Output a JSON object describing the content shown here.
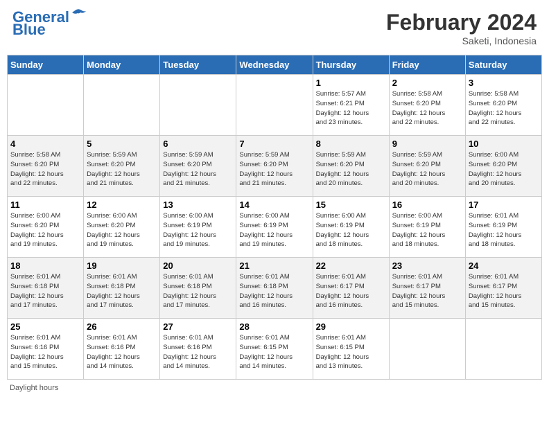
{
  "header": {
    "logo_line1": "General",
    "logo_line2": "Blue",
    "month_title": "February 2024",
    "location": "Saketi, Indonesia"
  },
  "days_of_week": [
    "Sunday",
    "Monday",
    "Tuesday",
    "Wednesday",
    "Thursday",
    "Friday",
    "Saturday"
  ],
  "footer_label": "Daylight hours",
  "weeks": [
    [
      {
        "day": "",
        "info": ""
      },
      {
        "day": "",
        "info": ""
      },
      {
        "day": "",
        "info": ""
      },
      {
        "day": "",
        "info": ""
      },
      {
        "day": "1",
        "info": "Sunrise: 5:57 AM\nSunset: 6:21 PM\nDaylight: 12 hours\nand 23 minutes."
      },
      {
        "day": "2",
        "info": "Sunrise: 5:58 AM\nSunset: 6:20 PM\nDaylight: 12 hours\nand 22 minutes."
      },
      {
        "day": "3",
        "info": "Sunrise: 5:58 AM\nSunset: 6:20 PM\nDaylight: 12 hours\nand 22 minutes."
      }
    ],
    [
      {
        "day": "4",
        "info": "Sunrise: 5:58 AM\nSunset: 6:20 PM\nDaylight: 12 hours\nand 22 minutes."
      },
      {
        "day": "5",
        "info": "Sunrise: 5:59 AM\nSunset: 6:20 PM\nDaylight: 12 hours\nand 21 minutes."
      },
      {
        "day": "6",
        "info": "Sunrise: 5:59 AM\nSunset: 6:20 PM\nDaylight: 12 hours\nand 21 minutes."
      },
      {
        "day": "7",
        "info": "Sunrise: 5:59 AM\nSunset: 6:20 PM\nDaylight: 12 hours\nand 21 minutes."
      },
      {
        "day": "8",
        "info": "Sunrise: 5:59 AM\nSunset: 6:20 PM\nDaylight: 12 hours\nand 20 minutes."
      },
      {
        "day": "9",
        "info": "Sunrise: 5:59 AM\nSunset: 6:20 PM\nDaylight: 12 hours\nand 20 minutes."
      },
      {
        "day": "10",
        "info": "Sunrise: 6:00 AM\nSunset: 6:20 PM\nDaylight: 12 hours\nand 20 minutes."
      }
    ],
    [
      {
        "day": "11",
        "info": "Sunrise: 6:00 AM\nSunset: 6:20 PM\nDaylight: 12 hours\nand 19 minutes."
      },
      {
        "day": "12",
        "info": "Sunrise: 6:00 AM\nSunset: 6:20 PM\nDaylight: 12 hours\nand 19 minutes."
      },
      {
        "day": "13",
        "info": "Sunrise: 6:00 AM\nSunset: 6:19 PM\nDaylight: 12 hours\nand 19 minutes."
      },
      {
        "day": "14",
        "info": "Sunrise: 6:00 AM\nSunset: 6:19 PM\nDaylight: 12 hours\nand 19 minutes."
      },
      {
        "day": "15",
        "info": "Sunrise: 6:00 AM\nSunset: 6:19 PM\nDaylight: 12 hours\nand 18 minutes."
      },
      {
        "day": "16",
        "info": "Sunrise: 6:00 AM\nSunset: 6:19 PM\nDaylight: 12 hours\nand 18 minutes."
      },
      {
        "day": "17",
        "info": "Sunrise: 6:01 AM\nSunset: 6:19 PM\nDaylight: 12 hours\nand 18 minutes."
      }
    ],
    [
      {
        "day": "18",
        "info": "Sunrise: 6:01 AM\nSunset: 6:18 PM\nDaylight: 12 hours\nand 17 minutes."
      },
      {
        "day": "19",
        "info": "Sunrise: 6:01 AM\nSunset: 6:18 PM\nDaylight: 12 hours\nand 17 minutes."
      },
      {
        "day": "20",
        "info": "Sunrise: 6:01 AM\nSunset: 6:18 PM\nDaylight: 12 hours\nand 17 minutes."
      },
      {
        "day": "21",
        "info": "Sunrise: 6:01 AM\nSunset: 6:18 PM\nDaylight: 12 hours\nand 16 minutes."
      },
      {
        "day": "22",
        "info": "Sunrise: 6:01 AM\nSunset: 6:17 PM\nDaylight: 12 hours\nand 16 minutes."
      },
      {
        "day": "23",
        "info": "Sunrise: 6:01 AM\nSunset: 6:17 PM\nDaylight: 12 hours\nand 15 minutes."
      },
      {
        "day": "24",
        "info": "Sunrise: 6:01 AM\nSunset: 6:17 PM\nDaylight: 12 hours\nand 15 minutes."
      }
    ],
    [
      {
        "day": "25",
        "info": "Sunrise: 6:01 AM\nSunset: 6:16 PM\nDaylight: 12 hours\nand 15 minutes."
      },
      {
        "day": "26",
        "info": "Sunrise: 6:01 AM\nSunset: 6:16 PM\nDaylight: 12 hours\nand 14 minutes."
      },
      {
        "day": "27",
        "info": "Sunrise: 6:01 AM\nSunset: 6:16 PM\nDaylight: 12 hours\nand 14 minutes."
      },
      {
        "day": "28",
        "info": "Sunrise: 6:01 AM\nSunset: 6:15 PM\nDaylight: 12 hours\nand 14 minutes."
      },
      {
        "day": "29",
        "info": "Sunrise: 6:01 AM\nSunset: 6:15 PM\nDaylight: 12 hours\nand 13 minutes."
      },
      {
        "day": "",
        "info": ""
      },
      {
        "day": "",
        "info": ""
      }
    ]
  ]
}
